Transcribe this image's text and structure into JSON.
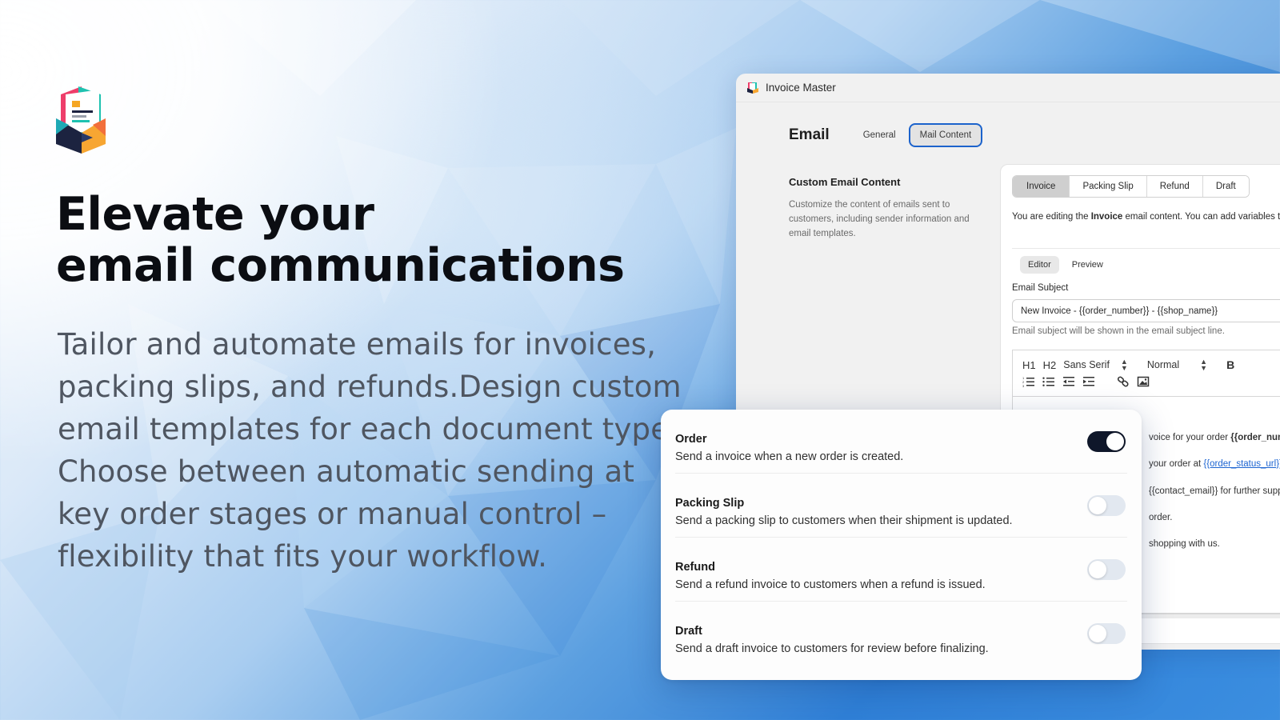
{
  "hero": {
    "headline_line1": "Elevate your",
    "headline_line2": "email communications",
    "description": "Tailor and automate emails for invoices, packing slips, and refunds.Design custom email templates for each document type. Choose between automatic sending at key order stages or manual control – flexibility that fits your workflow.",
    "logo_icon": "open-envelope-document-logo"
  },
  "app": {
    "title": "Invoice Master",
    "page_title": "Email",
    "nav_tabs": [
      {
        "label": "General",
        "active": false
      },
      {
        "label": "Mail Content",
        "active": true
      }
    ],
    "section": {
      "title": "Custom Email Content",
      "description": "Customize the content of emails sent to customers, including sender information and email templates."
    },
    "doc_tabs": [
      {
        "label": "Invoice",
        "active": true
      },
      {
        "label": "Packing Slip",
        "active": false
      },
      {
        "label": "Refund",
        "active": false
      },
      {
        "label": "Draft",
        "active": false
      }
    ],
    "edit_note": {
      "prefix": "You are editing the ",
      "doc": "Invoice",
      "suffix": " email content. You can add variables to personalize it."
    },
    "mode_tabs": [
      {
        "label": "Editor",
        "active": true
      },
      {
        "label": "Preview",
        "active": false
      }
    ],
    "subject": {
      "label": "Email Subject",
      "value": "New Invoice - {{order_number}} - {{shop_name}}",
      "help": "Email subject will be shown in the email subject line."
    },
    "toolbar": {
      "h1": "H1",
      "h2": "H2",
      "font": "Sans Serif",
      "size": "Normal",
      "bold": "B"
    },
    "editor_body": {
      "line1_text": "voice for your order ",
      "line1_var": "{{order_number}}",
      "line2_text": "your order at ",
      "line2_link": "{{order_status_url}}",
      "line3": "{{contact_email}} for further support.",
      "line4": "order.",
      "line5": "shopping with us."
    }
  },
  "settings": {
    "rows": [
      {
        "title": "Order",
        "desc": "Send a invoice when a new order is created.",
        "enabled": true
      },
      {
        "title": "Packing Slip",
        "desc": "Send a packing slip to customers when their shipment is updated.",
        "enabled": false
      },
      {
        "title": "Refund",
        "desc": "Send a refund invoice to customers when a refund is issued.",
        "enabled": false
      },
      {
        "title": "Draft",
        "desc": "Send a draft invoice to customers for review before finalizing.",
        "enabled": false
      }
    ]
  },
  "colors": {
    "toggle_on": "#0f172a",
    "toggle_off": "#e2e8f0",
    "active_tab_border": "#1c63cc",
    "link": "#1c64d1"
  }
}
